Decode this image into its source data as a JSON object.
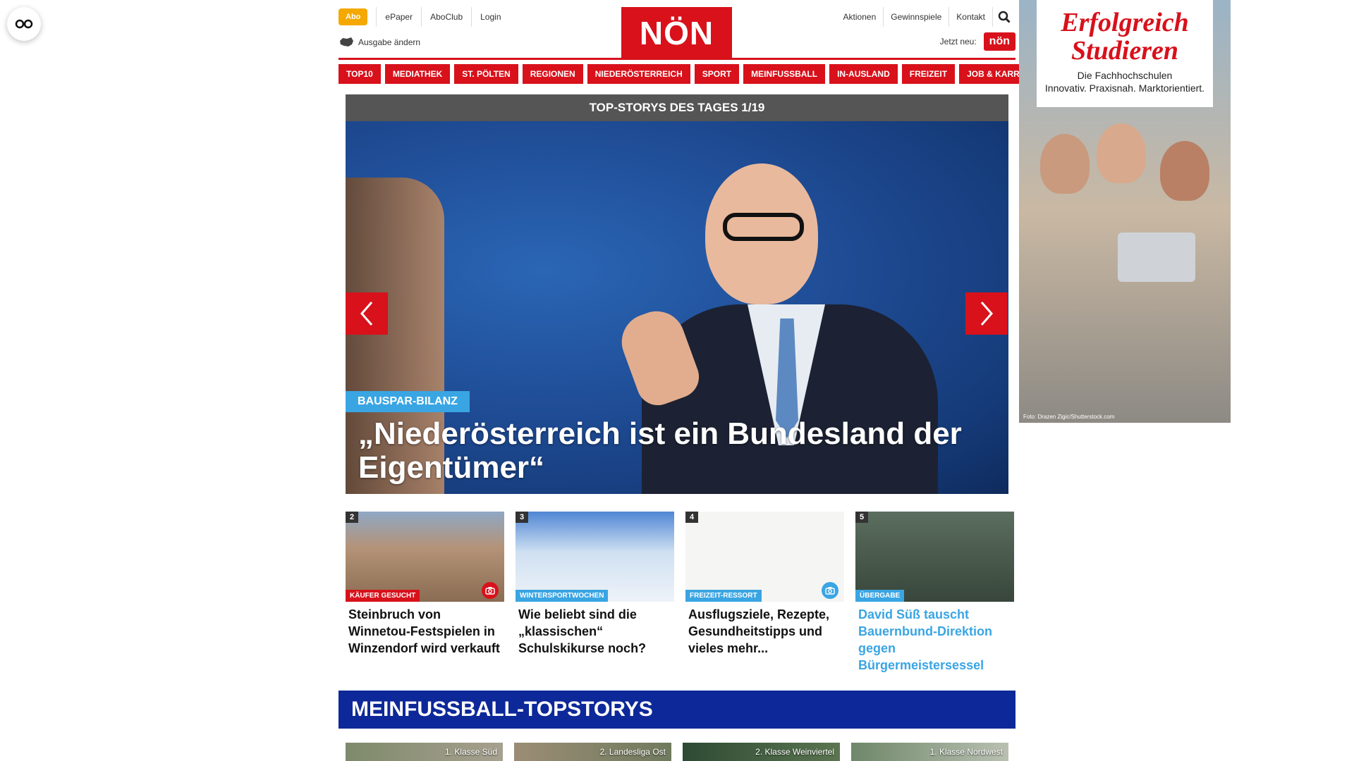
{
  "header": {
    "abo_label": "Abo",
    "top_links": [
      "ePaper",
      "AboClub",
      "Login"
    ],
    "ausgabe_label": "Ausgabe ändern",
    "logo_text": "NÖN",
    "right_links": [
      "Aktionen",
      "Gewinnspiele",
      "Kontakt"
    ],
    "jetzt_label": "Jetzt neu:",
    "jetzt_badge": "nön"
  },
  "categories": [
    "TOP10",
    "MEDIATHEK",
    "ST. PÖLTEN",
    "REGIONEN",
    "NIEDERÖSTERREICH",
    "SPORT",
    "MEINFUSSBALL",
    "IN-AUSLAND",
    "FREIZEIT",
    "JOB & KARRIERE"
  ],
  "hero": {
    "heading": "TOP-STORYS DES TAGES 1/19",
    "kicker": "BAUSPAR-BILANZ",
    "title": "„Niederösterreich ist ein Bundesland der Eigentümer“"
  },
  "teasers": [
    {
      "num": "2",
      "tag": "KÄUFER GESUCHT",
      "title": "Steinbruch von Winnetou-Festspielen in Winzendorf wird verkauft"
    },
    {
      "num": "3",
      "tag": "WINTERSPORTWOCHEN",
      "title": "Wie beliebt sind die „klassischen“ Schulskikurse noch?"
    },
    {
      "num": "4",
      "tag": "FREIZEIT-RESSORT",
      "title": "Ausflugsziele, Rezepte, Gesundheitstipps und vieles mehr..."
    },
    {
      "num": "5",
      "tag": "ÜBERGABE",
      "title": "David Süß tauscht Bauernbund-Direktion gegen Bürgermeistersessel"
    }
  ],
  "section": {
    "title": "MEINFUSSBALL-TOPSTORYS",
    "leagues": [
      "1. Klasse Süd",
      "2. Landesliga Ost",
      "2. Klasse Weinviertel",
      "1. Klasse Nordwest"
    ]
  },
  "ad": {
    "headline_line1": "Erfolgreich",
    "headline_line2": "Studieren",
    "sub_line1": "Die Fachhochschulen",
    "sub_line2": "Innovativ. Praxisnah. Marktorientiert.",
    "credit": "Foto: Drazen Zigic/Shutterstock.com"
  },
  "colors": {
    "brand_red": "#d8111b",
    "abo_orange": "#f5a800",
    "accent_blue": "#3aa5e3",
    "section_blue": "#0d2898"
  }
}
